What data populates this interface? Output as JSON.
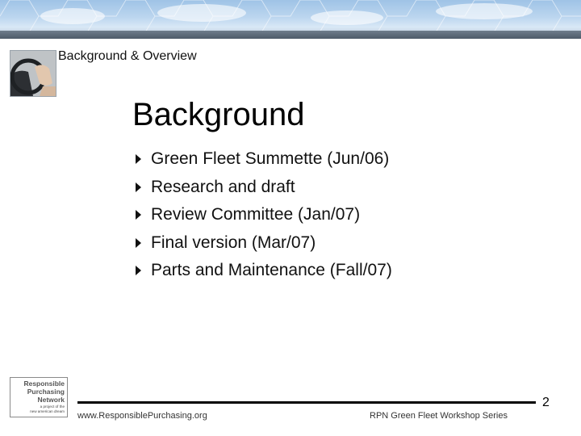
{
  "header": {
    "section_title": "Background & Overview"
  },
  "slide": {
    "title": "Background",
    "bullets": [
      "Green Fleet Summette (Jun/06)",
      "Research and draft",
      "Review Committee (Jan/07)",
      "Final version (Mar/07)",
      "Parts and Maintenance (Fall/07)"
    ]
  },
  "footer": {
    "url": "www.ResponsiblePurchasing.org",
    "series": "RPN Green Fleet Workshop Series",
    "page_number": "2"
  },
  "logo": {
    "line1": "Responsible",
    "line2": "Purchasing",
    "line3": "Network",
    "tagline1": "a project of the",
    "tagline2": "new american dream"
  },
  "colors": {
    "banner_sky": "#bcd6ef",
    "banner_bar": "#5a6775",
    "text": "#111111"
  },
  "icons": {
    "bullet": "triangle-right-icon",
    "thumbnail": "steering-wheel-photo"
  }
}
